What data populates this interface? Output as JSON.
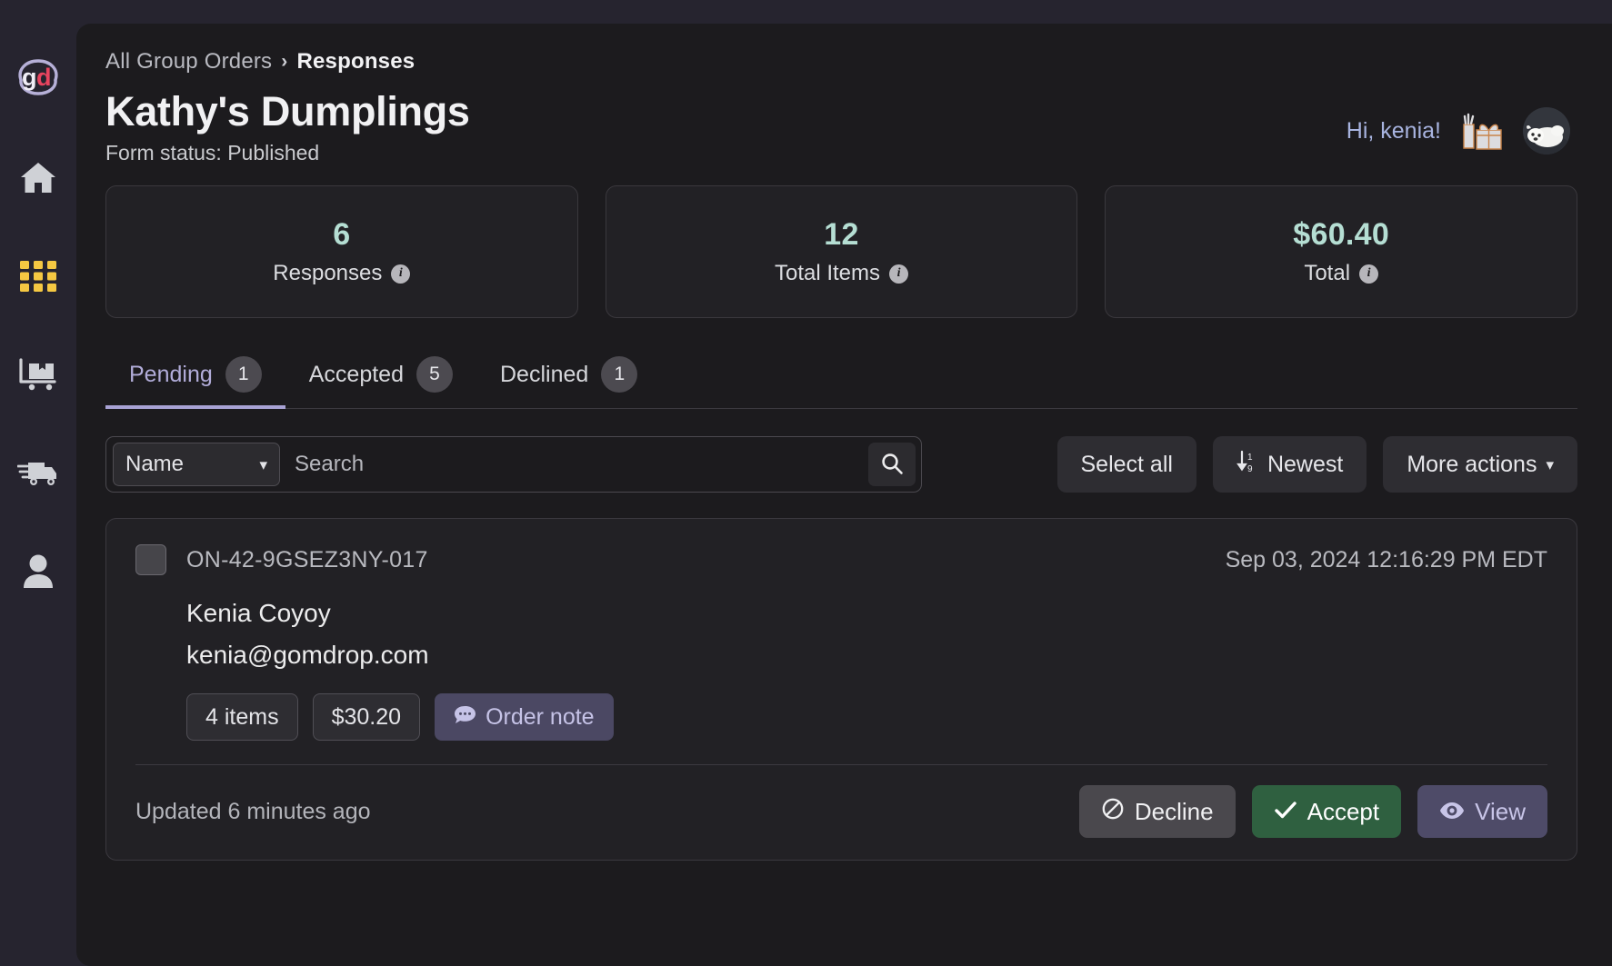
{
  "sidebar": {
    "logo_label": "gd",
    "items": [
      {
        "name": "home",
        "label": "Home"
      },
      {
        "name": "grid",
        "label": "Group Orders"
      },
      {
        "name": "inventory",
        "label": "Inventory"
      },
      {
        "name": "shipping",
        "label": "Shipping"
      },
      {
        "name": "account",
        "label": "Account"
      }
    ]
  },
  "breadcrumb": {
    "parent": "All Group Orders",
    "separator": "›",
    "current": "Responses"
  },
  "header": {
    "title": "Kathy's Dumplings",
    "form_status": "Form status: Published",
    "greeting": "Hi, kenia!"
  },
  "stats": [
    {
      "value": "6",
      "label": "Responses",
      "info": "i"
    },
    {
      "value": "12",
      "label": "Total Items",
      "info": "i"
    },
    {
      "value": "$60.40",
      "label": "Total",
      "info": "i"
    }
  ],
  "tabs": [
    {
      "label": "Pending",
      "count": "1",
      "active": true
    },
    {
      "label": "Accepted",
      "count": "5",
      "active": false
    },
    {
      "label": "Declined",
      "count": "1",
      "active": false
    }
  ],
  "controls": {
    "filter_field": "Name",
    "search_placeholder": "Search",
    "search_value": "",
    "select_all_label": "Select all",
    "sort_label": "Newest",
    "more_actions_label": "More actions"
  },
  "responses": [
    {
      "order_id": "ON-42-9GSEZ3NY-017",
      "timestamp": "Sep 03, 2024 12:16:29 PM EDT",
      "name": "Kenia Coyoy",
      "email": "kenia@gomdrop.com",
      "items_badge": "4 items",
      "price_badge": "$30.20",
      "note_badge": "Order note",
      "updated": "Updated 6 minutes ago",
      "decline_label": "Decline",
      "accept_label": "Accept",
      "view_label": "View"
    }
  ],
  "colors": {
    "accent_mint": "#b5ded3",
    "accent_purple": "#a8a2d4",
    "greeting_blue": "#a8b4e0",
    "accept_green": "#2f6040",
    "logo_red": "#e8445f",
    "grid_yellow": "#f5c842"
  }
}
